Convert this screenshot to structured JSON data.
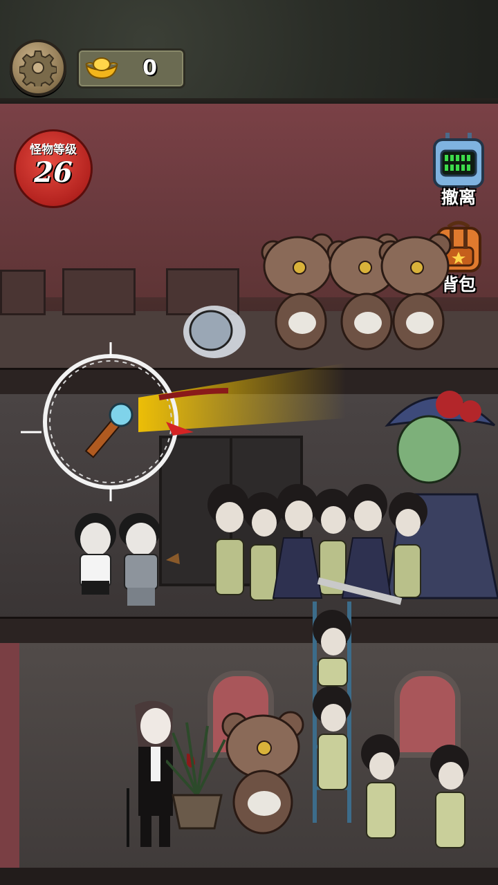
{
  "hud": {
    "gold_value": "0",
    "monster_level_label": "怪物等级",
    "monster_level_value": "26"
  },
  "side_buttons": {
    "evacuate_label": "撤离",
    "backpack_label": "背包"
  },
  "icons": {
    "settings": "gear-icon",
    "gold": "gold-ingot-icon",
    "evacuate": "walkie-talkie-icon",
    "backpack": "backpack-icon"
  },
  "colors": {
    "moon_red": "#c9302a",
    "gold_box": "#6b6b52",
    "roof_wall": "#6a3a3e"
  }
}
